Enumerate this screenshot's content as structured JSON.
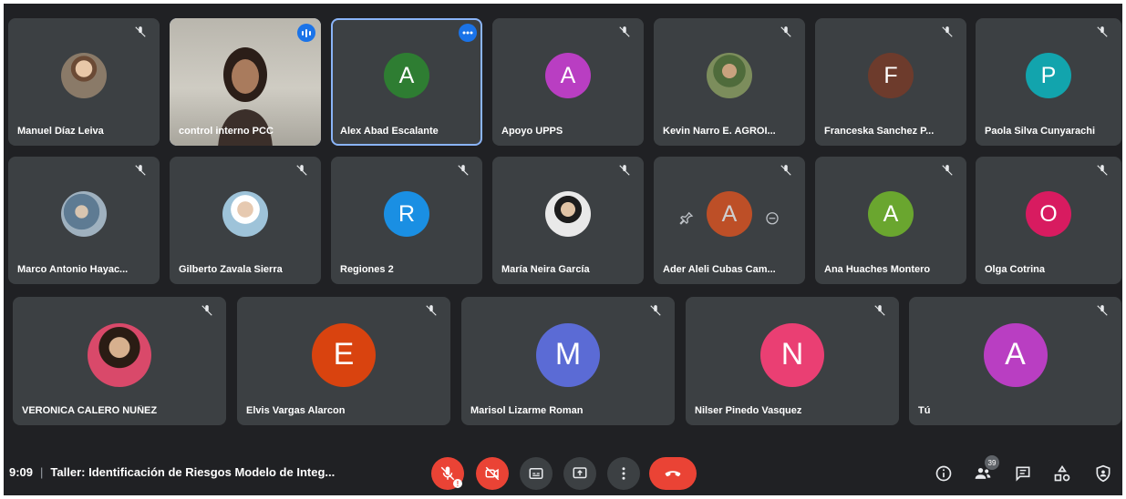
{
  "colors": {
    "background": "#202124",
    "tile": "#3c4043",
    "accent": "#1a73e8",
    "danger": "#ea4335"
  },
  "participants_row1": [
    {
      "name": "Manuel Díaz Leiva",
      "type": "photo"
    },
    {
      "name": "control interno PCC",
      "type": "video"
    },
    {
      "name": "Alex Abad Escalante",
      "initial": "A",
      "color": "#2e7d32"
    },
    {
      "name": "Apoyo UPPS",
      "initial": "A",
      "color": "#b93ec2"
    },
    {
      "name": "Kevin Narro E. AGROI...",
      "type": "photo"
    },
    {
      "name": "Franceska Sanchez P...",
      "initial": "F",
      "color": "#6d3b2c"
    },
    {
      "name": "Paola Silva Cunyarachi",
      "initial": "P",
      "color": "#12a4ad"
    }
  ],
  "participants_row2": [
    {
      "name": "Marco Antonio Hayac...",
      "type": "photo"
    },
    {
      "name": "Gilberto Zavala Sierra",
      "type": "photo"
    },
    {
      "name": "Regiones 2",
      "initial": "R",
      "color": "#1a8fe3"
    },
    {
      "name": "María Neira García",
      "type": "photo"
    },
    {
      "name": "Ader Aleli Cubas Cam...",
      "initial": "A",
      "color": "#e8541e"
    },
    {
      "name": "Ana Huaches Montero",
      "initial": "A",
      "color": "#6aa62f"
    },
    {
      "name": "Olga Cotrina",
      "initial": "O",
      "color": "#d81b60"
    }
  ],
  "participants_row3": [
    {
      "name": "VERONICA CALERO NUÑEZ",
      "type": "photo"
    },
    {
      "name": "Elvis Vargas Alarcon",
      "initial": "E",
      "color": "#d9430f"
    },
    {
      "name": "Marisol Lizarme Roman",
      "initial": "M",
      "color": "#5b6bd5"
    },
    {
      "name": "Nilser Pinedo Vasquez",
      "initial": "N",
      "color": "#ea3f73"
    },
    {
      "name": "Tú",
      "initial": "A",
      "color": "#b93ec2"
    }
  ],
  "meeting": {
    "time": "9:09",
    "separator": "|",
    "title": "Taller: Identificación de Riesgos Modelo de Integ..."
  },
  "people_count": "39",
  "icons": {
    "mic": "mic-off-icon",
    "camera": "camera-off-icon",
    "captions": "captions-icon",
    "present": "present-screen-icon",
    "more": "more-vert-icon",
    "end": "end-call-icon",
    "info": "info-icon",
    "people": "people-icon",
    "chat": "chat-icon",
    "activities": "activities-icon",
    "host": "host-controls-icon"
  }
}
